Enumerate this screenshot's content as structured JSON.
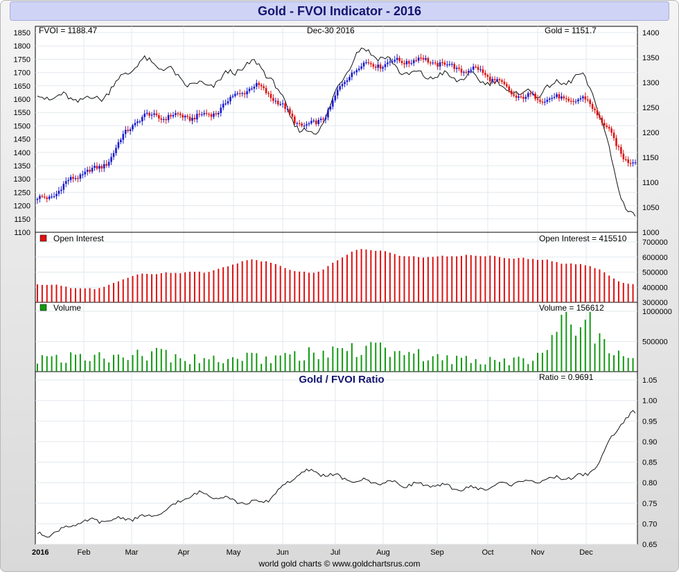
{
  "title": "Gold - FVOI Indicator - 2016",
  "footer": "world gold charts © www.goldchartsrus.com",
  "price_panel": {
    "fvoi_label": "FVOI = 1188.47",
    "date_label": "Dec-30  2016",
    "gold_label": "Gold = 1151.7",
    "left_ticks": [
      "1850",
      "1800",
      "1750",
      "1700",
      "1650",
      "1600",
      "1550",
      "1500",
      "1450",
      "1400",
      "1350",
      "1300",
      "1250",
      "1200",
      "1150",
      "1100"
    ],
    "right_ticks": [
      "1400",
      "1350",
      "1300",
      "1250",
      "1200",
      "1150",
      "1100",
      "1050",
      "1000"
    ]
  },
  "oi_panel": {
    "legend": "Open Interest",
    "value_label": "Open Interest = 415510",
    "ticks": [
      "700000",
      "600000",
      "500000",
      "400000",
      "300000"
    ]
  },
  "vol_panel": {
    "legend": "Volume",
    "value_label": "Volume = 156612",
    "ticks": [
      "1000000",
      "500000"
    ]
  },
  "ratio_panel": {
    "title": "Gold / FVOI Ratio",
    "value_label": "Ratio = 0.9691",
    "ticks": [
      "1.05",
      "1.00",
      "0.95",
      "0.90",
      "0.85",
      "0.80",
      "0.75",
      "0.70",
      "0.65"
    ]
  },
  "months": [
    "2016",
    "Feb",
    "Mar",
    "Apr",
    "May",
    "Jun",
    "Jul",
    "Aug",
    "Sep",
    "Oct",
    "Nov",
    "Dec"
  ],
  "colors": {
    "up": "#1a1acc",
    "down": "#dd1111",
    "oi": "#dd1111",
    "volume": "#119911",
    "line": "#111111"
  },
  "chart_data": [
    {
      "type": "line",
      "title": "Gold - FVOI Indicator - 2016",
      "x": [
        "2016",
        "Feb",
        "Mar",
        "Apr",
        "May",
        "Jun",
        "Jul",
        "Aug",
        "Sep",
        "Oct",
        "Nov",
        "Dec"
      ],
      "series": [
        {
          "name": "Gold",
          "values": [
            1065,
            1123,
            1232,
            1232,
            1290,
            1213,
            1335,
            1345,
            1325,
            1270,
            1265,
            1140
          ]
        },
        {
          "name": "FVOI",
          "values": [
            1610,
            1600,
            1740,
            1650,
            1730,
            1470,
            1780,
            1690,
            1680,
            1620,
            1680,
            1160
          ]
        }
      ],
      "ylim": [
        1100,
        1850
      ],
      "y2lim": [
        1000,
        1400
      ]
    },
    {
      "type": "bar",
      "x": [
        "2016",
        "Feb",
        "Mar",
        "Apr",
        "May",
        "Jun",
        "Jul",
        "Aug",
        "Sep",
        "Oct",
        "Nov",
        "Dec"
      ],
      "series": [
        {
          "name": "Open Interest",
          "values": [
            420000,
            390000,
            490000,
            500000,
            580000,
            495000,
            650000,
            600000,
            610000,
            590000,
            550000,
            415510
          ]
        }
      ],
      "ylim": [
        300000,
        700000
      ]
    },
    {
      "type": "bar",
      "x": [
        "2016",
        "Feb",
        "Mar",
        "Apr",
        "May",
        "Jun",
        "Jul",
        "Aug",
        "Sep",
        "Oct",
        "Nov",
        "Dec"
      ],
      "series": [
        {
          "name": "Volume",
          "values": [
            200000,
            250000,
            320000,
            200000,
            220000,
            280000,
            380000,
            260000,
            190000,
            190000,
            850000,
            156612
          ]
        }
      ],
      "ylim": [
        0,
        1000000
      ]
    },
    {
      "type": "line",
      "title": "Gold / FVOI Ratio",
      "x": [
        "2016",
        "Feb",
        "Mar",
        "Apr",
        "May",
        "Jun",
        "Jul",
        "Aug",
        "Sep",
        "Oct",
        "Nov",
        "Dec"
      ],
      "series": [
        {
          "name": "Ratio",
          "values": [
            0.672,
            0.706,
            0.716,
            0.772,
            0.75,
            0.826,
            0.803,
            0.795,
            0.785,
            0.803,
            0.815,
            0.9691
          ]
        }
      ],
      "ylim": [
        0.65,
        1.05
      ]
    }
  ]
}
